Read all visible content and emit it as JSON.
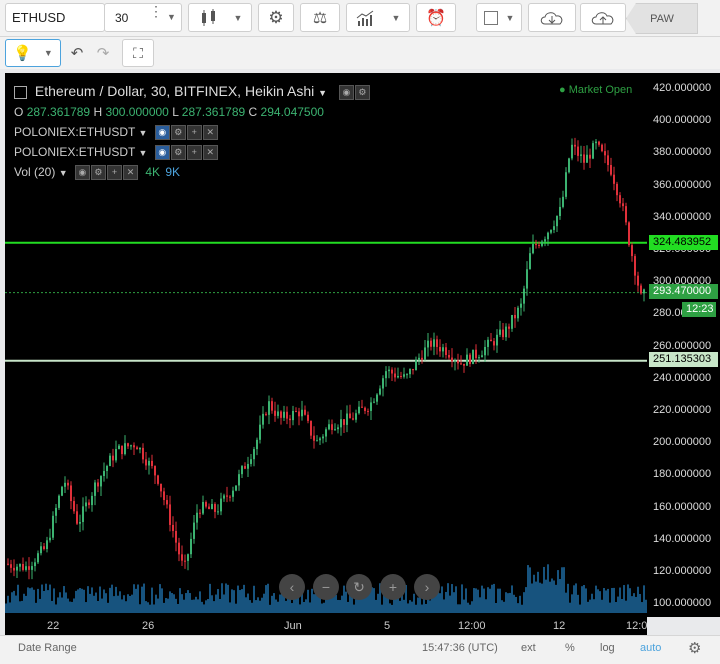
{
  "toolbar": {
    "symbol": "ETHUSD",
    "interval": "30",
    "mode_label": "PAW"
  },
  "chart": {
    "title": "Ethereum / Dollar, 30, BITFINEX, Heikin Ashi",
    "market_status": "Market Open",
    "ohlc": {
      "o_label": "O",
      "o": "287.361789",
      "h_label": "H",
      "h": "300.000000",
      "l_label": "L",
      "l": "287.361789",
      "c_label": "C",
      "c": "294.047500"
    },
    "studies": [
      {
        "name": "POLONIEX:ETHUSDT"
      },
      {
        "name": "POLONIEX:ETHUSDT"
      }
    ],
    "volume": {
      "name": "Vol (20)",
      "v1": "4K",
      "v2": "9K"
    }
  },
  "price_axis": {
    "ticks": [
      "420.000000",
      "400.000000",
      "380.000000",
      "360.000000",
      "340.000000",
      "320.000000",
      "300.000000",
      "280.000000",
      "260.000000",
      "240.000000",
      "220.000000",
      "200.000000",
      "180.000000",
      "160.000000",
      "140.000000",
      "120.000000",
      "100.000000"
    ],
    "line_high": "324.483952",
    "last_price": "293.470000",
    "countdown": "12:23",
    "line_low": "251.135303"
  },
  "time_axis": {
    "labels": [
      "22",
      "26",
      "Jun",
      "5",
      "12:00",
      "12",
      "12:0"
    ]
  },
  "bottom_bar": {
    "date_range": "Date Range",
    "clock": "15:47:36 (UTC)",
    "ext": "ext",
    "percent": "%",
    "log": "log",
    "auto": "auto"
  },
  "colors": {
    "up": "#3cb371",
    "down": "#e0303a",
    "hline": "#22dd22",
    "price_line": "#2ea043",
    "volume": "#1f6fa8",
    "accent": "#4ca3dd"
  }
}
